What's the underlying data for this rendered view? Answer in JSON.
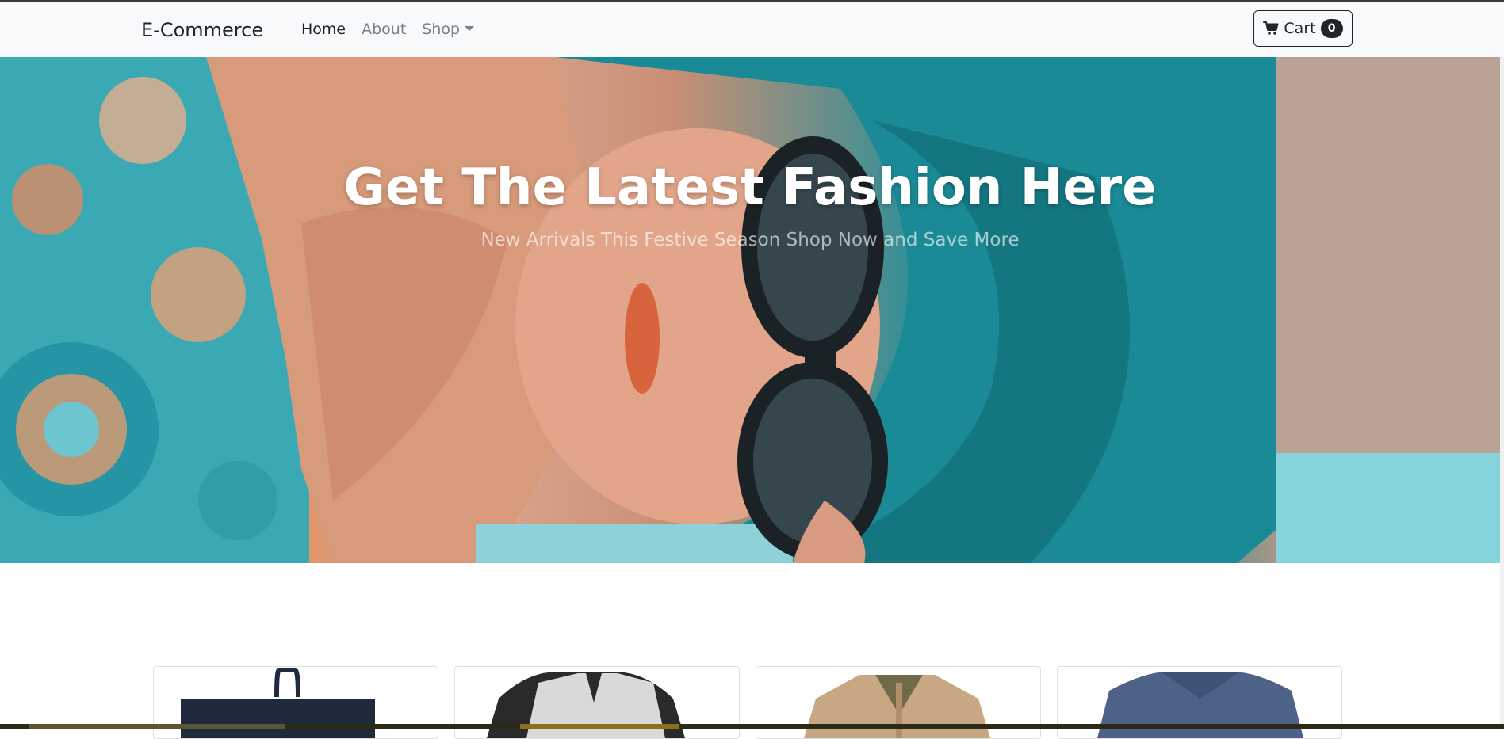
{
  "nav": {
    "brand": "E-Commerce",
    "links": [
      {
        "label": "Home",
        "active": true
      },
      {
        "label": "About",
        "active": false
      },
      {
        "label": "Shop",
        "active": false,
        "dropdown": true
      }
    ],
    "cart": {
      "label": "Cart",
      "count": "0",
      "icon": "cart-icon"
    }
  },
  "hero": {
    "title": "Get The Latest Fashion Here",
    "subtitle": "New Arrivals This Festive Season Shop Now and Save More"
  },
  "products": [
    {
      "name": "bag",
      "color": "#1f2a3d"
    },
    {
      "name": "raglan-tshirt",
      "color": "#2a2a2a"
    },
    {
      "name": "jacket",
      "color": "#c8a883"
    },
    {
      "name": "vneck-tshirt",
      "color": "#4e6289"
    }
  ],
  "colors": {
    "navbar_bg": "#f8f9fa",
    "text_dark": "#212529",
    "nav_muted": "#7a7f84"
  }
}
